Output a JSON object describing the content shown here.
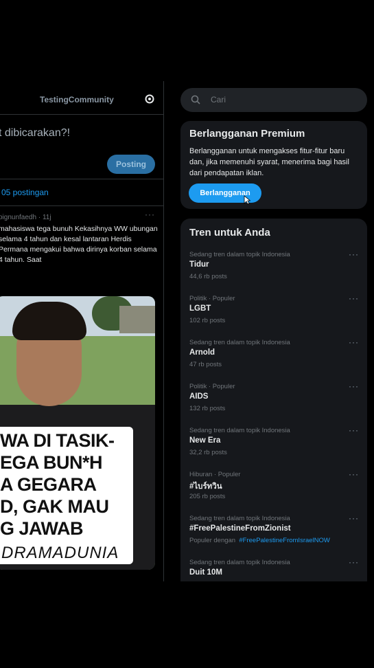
{
  "community": {
    "title": "TestingCommunity",
    "compose_placeholder": "t dibicarakan?!",
    "post_label": "Posting",
    "post_count": "05 postingan"
  },
  "tweet": {
    "meta": "oignunfaedh · 11j",
    "more": "···",
    "text": "mahasiswa tega bunuh Kekasihnya WW ubungan selama 4 tahun dan kesal lantaran Herdis Permana mengakui bahwa dirinya korban selama 4 tahun. Saat",
    "media_caption": [
      "WA DI TASIK-",
      "EGA BUN*H",
      "A GEGARA",
      "D, GAK MAU",
      "G JAWAB"
    ],
    "media_brand": "DRAMADUNIA"
  },
  "search": {
    "placeholder": "Cari"
  },
  "premium": {
    "title": "Berlangganan Premium",
    "description": "Berlangganan untuk mengakses fitur-fitur baru dan, jika memenuhi syarat, menerima bagi hasil dari pendapatan iklan.",
    "button": "Berlangganan"
  },
  "trends": {
    "title": "Tren untuk Anda",
    "items": [
      {
        "context": "Sedang tren dalam topik Indonesia",
        "name": "Tidur",
        "count": "44,6 rb posts",
        "more": "···"
      },
      {
        "context": "Politik · Populer",
        "name": "LGBT",
        "count": "102 rb posts",
        "more": "···"
      },
      {
        "context": "Sedang tren dalam topik Indonesia",
        "name": "Arnold",
        "count": "47 rb posts",
        "more": "···"
      },
      {
        "context": "Politik · Populer",
        "name": "AIDS",
        "count": "132 rb posts",
        "more": "···"
      },
      {
        "context": "Sedang tren dalam topik Indonesia",
        "name": "New Era",
        "count": "32,2 rb posts",
        "more": "···"
      },
      {
        "context": "Hiburan · Populer",
        "name": "#ไบร์ทวิน",
        "count": "205 rb posts",
        "more": "···"
      },
      {
        "context": "Sedang tren dalam topik Indonesia",
        "name": "#FreePalestineFromZionist",
        "count_prefix": "Populer dengan",
        "count_link": "#FreePalestineFromIsraelNOW",
        "more": "···"
      },
      {
        "context": "Sedang tren dalam topik Indonesia",
        "name": "Duit 10M",
        "more": "···"
      }
    ]
  },
  "colors": {
    "accent": "#1d9bf0",
    "background": "#000000",
    "card": "#16181c",
    "muted": "#71767b"
  }
}
